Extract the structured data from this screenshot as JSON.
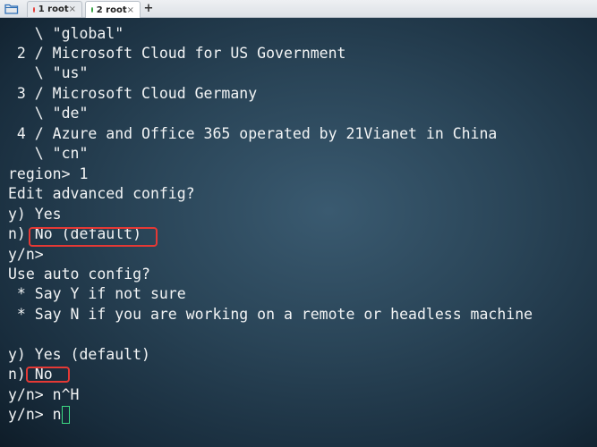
{
  "tabs": [
    {
      "label": "1 root",
      "dot_color": "#e53935",
      "active": false
    },
    {
      "label": "2 root",
      "dot_color": "#2e9e3a",
      "active": true
    }
  ],
  "tab_close_glyph": "×",
  "new_tab_glyph": "+",
  "terminal": {
    "lines": [
      "   \\ \"global\"",
      " 2 / Microsoft Cloud for US Government",
      "   \\ \"us\"",
      " 3 / Microsoft Cloud Germany",
      "   \\ \"de\"",
      " 4 / Azure and Office 365 operated by 21Vianet in China",
      "   \\ \"cn\"",
      "region> 1",
      "Edit advanced config?",
      "y) Yes",
      "n) No (default)",
      "y/n>",
      "Use auto config?",
      " * Say Y if not sure",
      " * Say N if you are working on a remote or headless machine",
      "",
      "y) Yes (default)",
      "n) No",
      "y/n> n^H",
      "y/n> n"
    ],
    "highlight_color": "#e53935",
    "cursor_color": "#3ddc84"
  },
  "icons": {
    "folder": "folder-icon",
    "close": "close-icon",
    "plus": "plus-icon"
  }
}
